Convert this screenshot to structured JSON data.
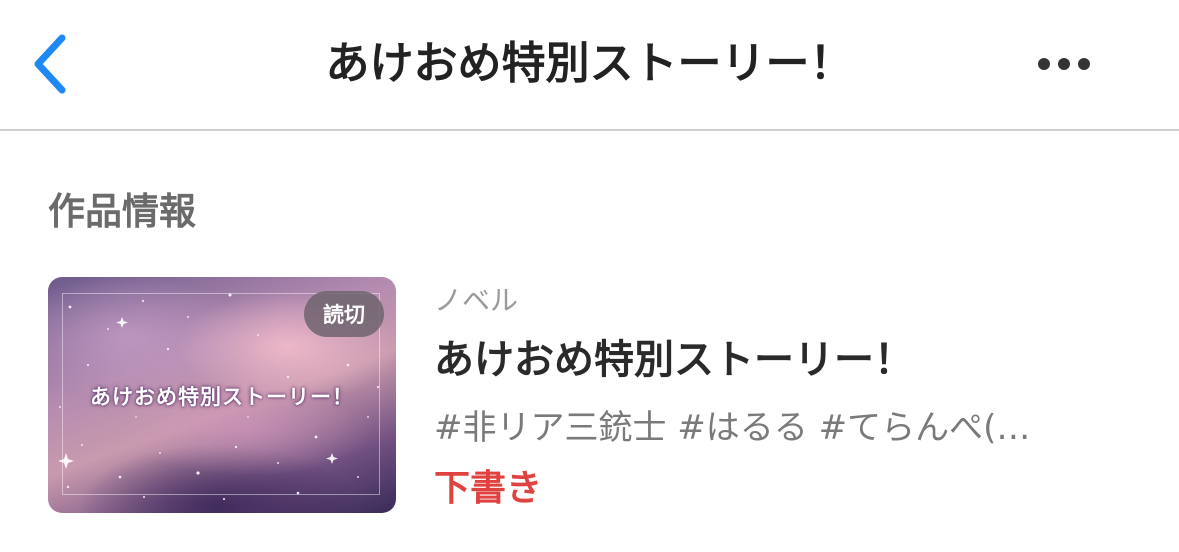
{
  "header": {
    "back_icon": "chevron-left-icon",
    "title": "あけおめ特別ストーリー！",
    "more_icon": "ellipsis-icon"
  },
  "section": {
    "heading": "作品情報"
  },
  "work": {
    "cover_title": "あけおめ特別ストーリー！",
    "badge": "読切",
    "category": "ノベル",
    "title": "あけおめ特別ストーリー！",
    "tags": "#非リア三銃士 #はるる #てらんぺ(…",
    "status": "下書き"
  },
  "colors": {
    "accent_blue": "#1e88f5",
    "status_red": "#e0433f",
    "divider": "#cfcfcf"
  }
}
